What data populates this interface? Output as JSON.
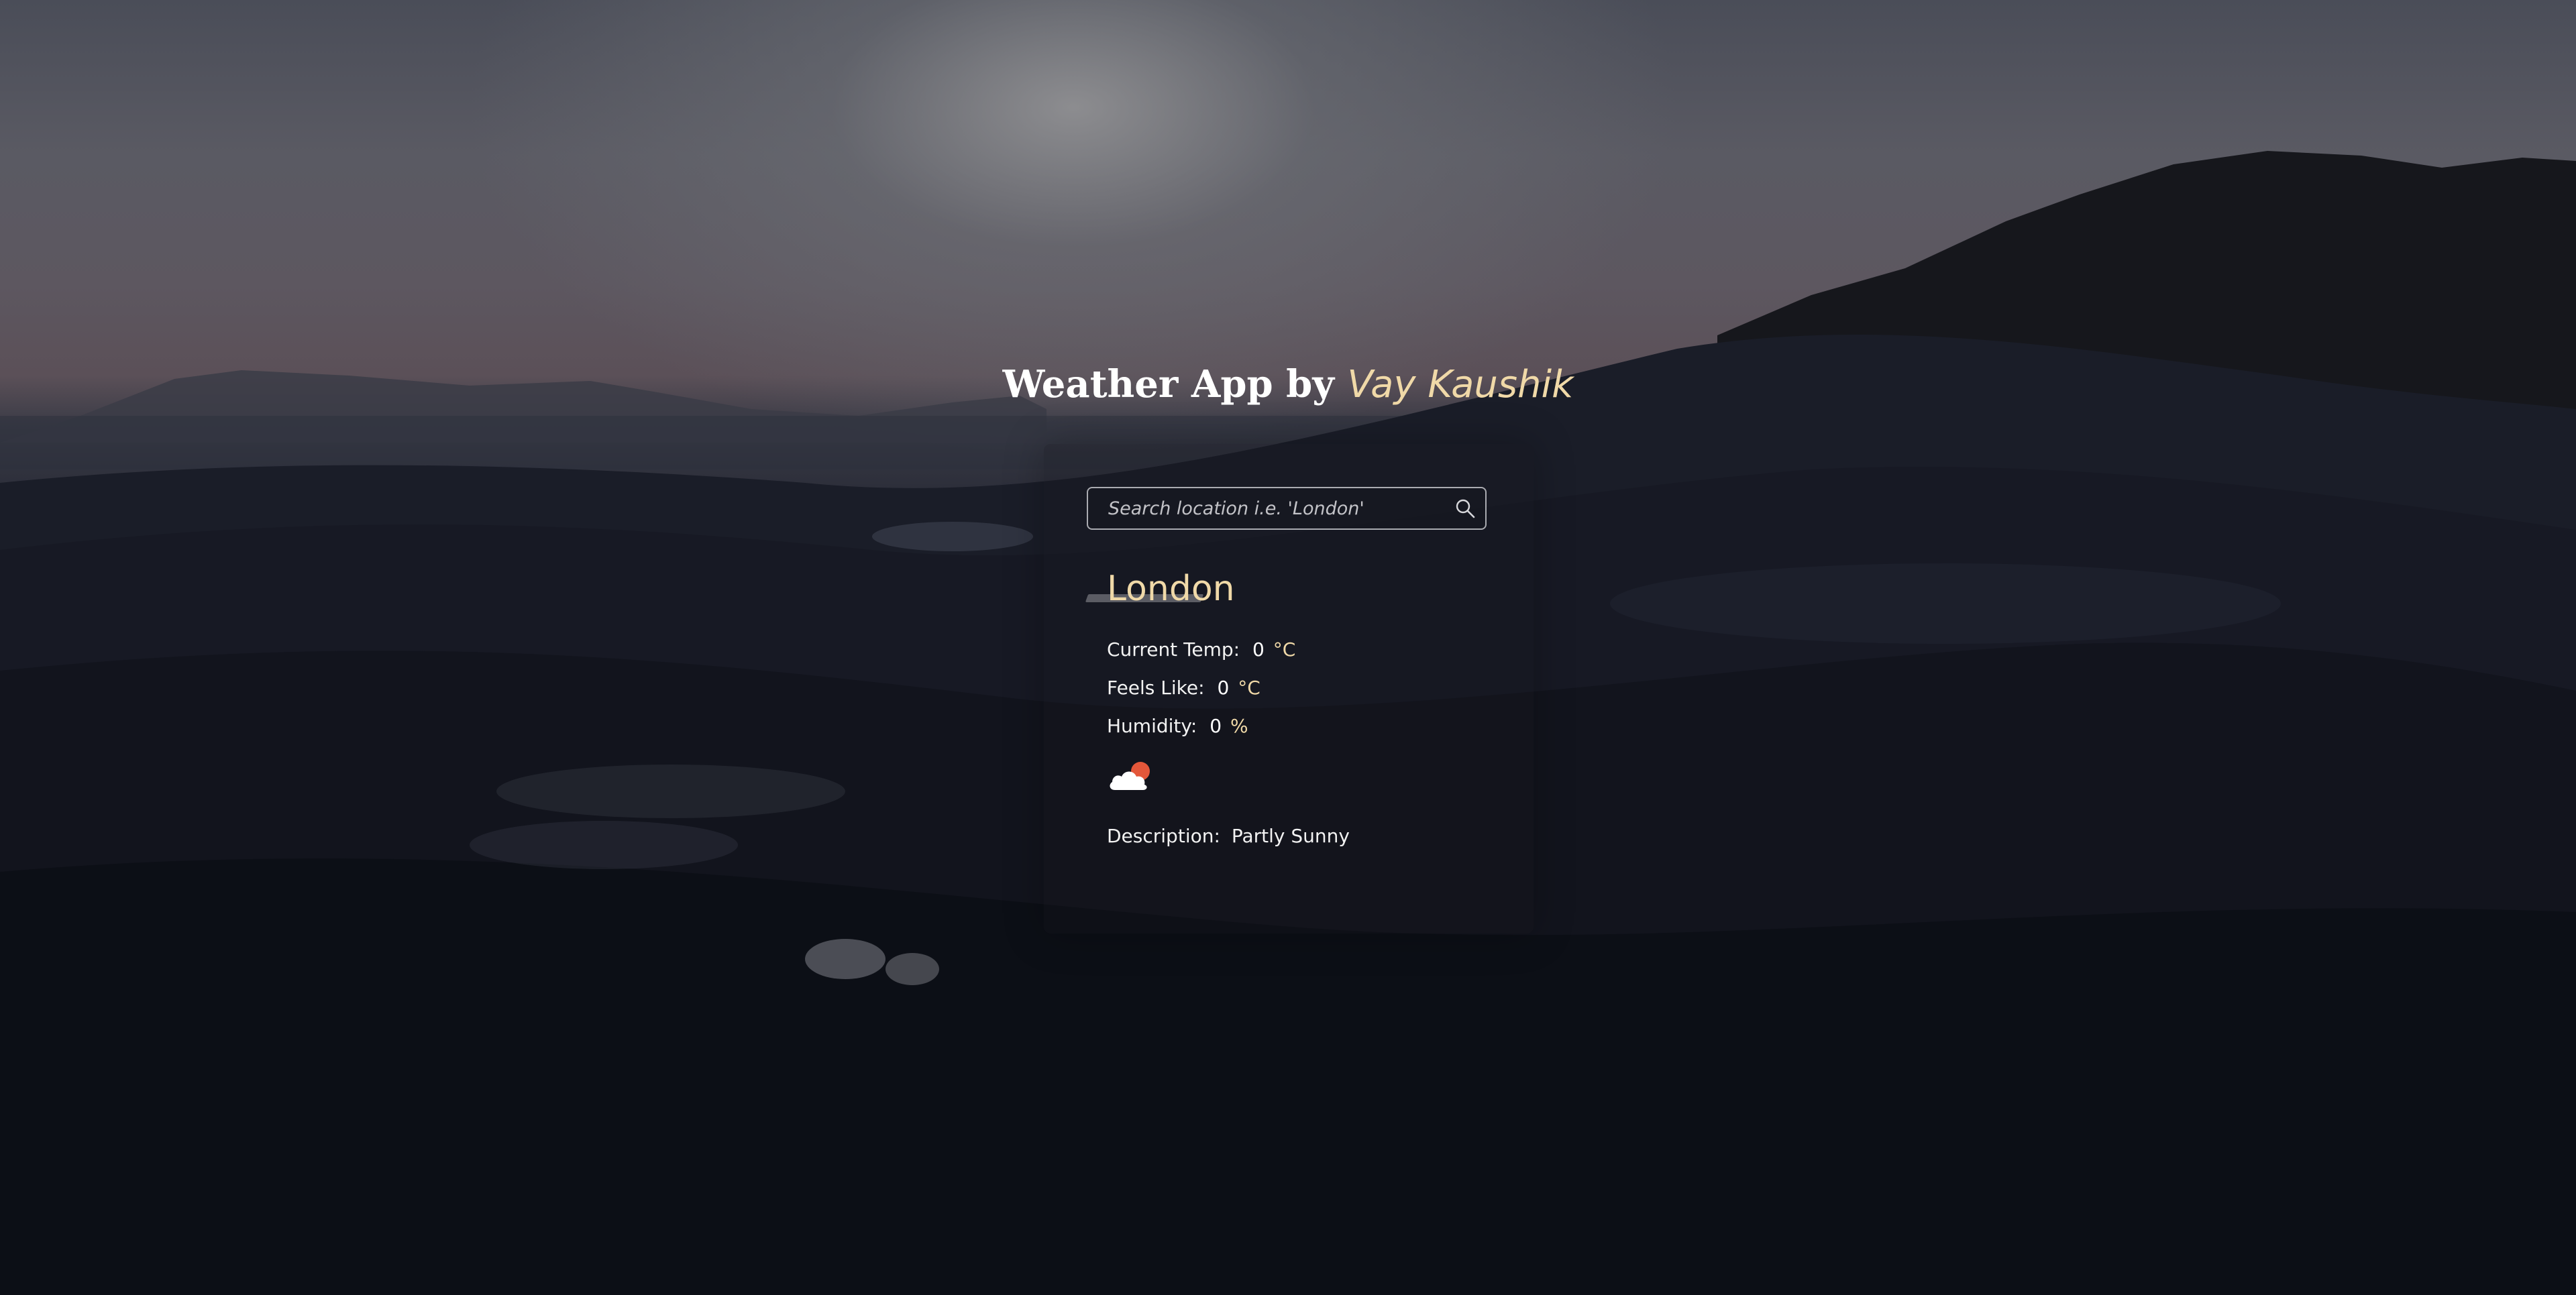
{
  "app": {
    "title_main": "Weather App by",
    "title_author": "Vay Kaushik"
  },
  "search": {
    "placeholder": "Search location i.e. 'London'",
    "value": "",
    "icon": "search-icon"
  },
  "weather": {
    "city": "London",
    "current_temp_label": "Current Temp:",
    "current_temp_value": "0",
    "current_temp_unit": "°C",
    "feels_like_label": "Feels Like:",
    "feels_like_value": "0",
    "feels_like_unit": "°C",
    "humidity_label": "Humidity:",
    "humidity_value": "0",
    "humidity_unit": "%",
    "icon": "partly-sunny-icon",
    "description_label": "Description:",
    "description_value": "Partly Sunny"
  },
  "colors": {
    "accent": "#f0d9a8",
    "text": "#f2f2f2",
    "sun": "#e4573a"
  }
}
